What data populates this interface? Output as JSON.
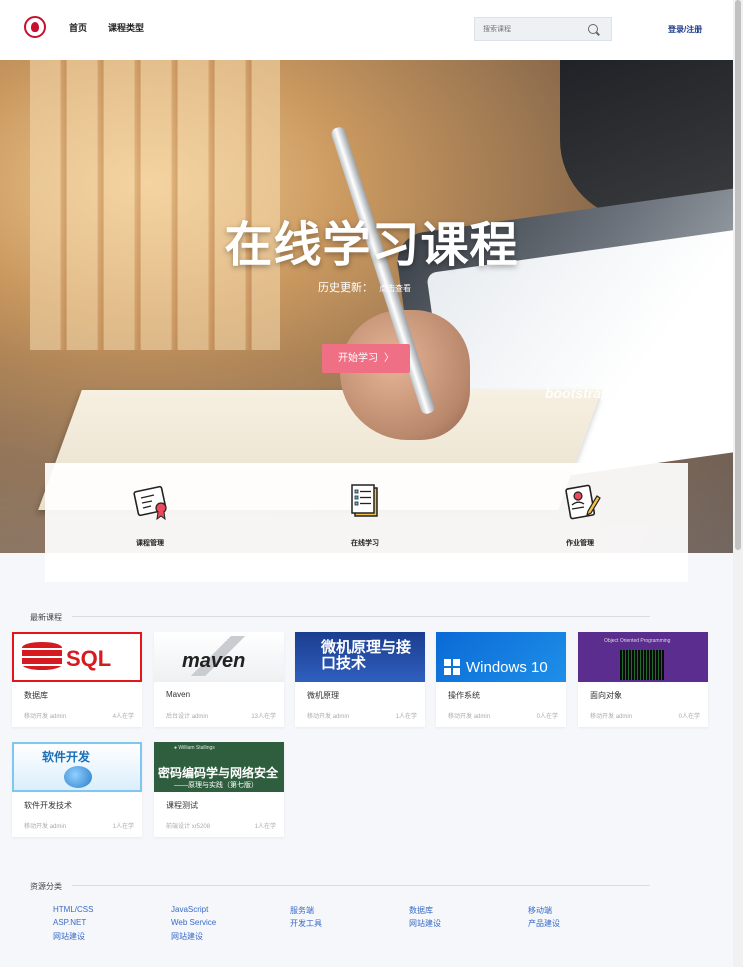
{
  "header": {
    "nav": [
      {
        "label": "首页"
      },
      {
        "label": "课程类型"
      }
    ],
    "search": {
      "placeholder": "搜索课程"
    },
    "login_label": "登录/注册"
  },
  "hero": {
    "title": "在线学习课程",
    "update_label": "历史更新：",
    "update_link": "点击查看",
    "start_button": "开始学习",
    "start_chevron": "〉",
    "watermark": "bootstrapmb.com"
  },
  "features": [
    {
      "label": "课程管理",
      "icon": "certificate-icon"
    },
    {
      "label": "在线学习",
      "icon": "document-icon"
    },
    {
      "label": "作业管理",
      "icon": "resume-edit-icon"
    }
  ],
  "courses": {
    "section_title": "最新课程",
    "items": [
      {
        "name": "数据库",
        "category": "移动开发",
        "author": "admin",
        "count": "4人在学",
        "thumb_text": "SQL"
      },
      {
        "name": "Maven",
        "category": "后台设计",
        "author": "admin",
        "count": "13人在学",
        "thumb_text": "maven"
      },
      {
        "name": "微机原理",
        "category": "移动开发",
        "author": "admin",
        "count": "1人在学",
        "thumb_text": "微机原理与接口技术"
      },
      {
        "name": "操作系统",
        "category": "移动开发",
        "author": "admin",
        "count": "0人在学",
        "thumb_text": "Windows 10"
      },
      {
        "name": "面向对象",
        "category": "移动开发",
        "author": "admin",
        "count": "0人在学",
        "thumb_text": "Object Oriented Programming"
      },
      {
        "name": "软件开发技术",
        "category": "移动开发",
        "author": "admin",
        "count": "1人在学",
        "thumb_text": "软件开发"
      },
      {
        "name": "课程测试",
        "category": "前端设计",
        "author": "xr5208",
        "count": "1人在学",
        "thumb_text": "密码编码学与网络安全",
        "thumb_sub": "——原理与实践（第七版）",
        "thumb_author": "● William Stallings"
      }
    ]
  },
  "resources": {
    "section_title": "资源分类",
    "columns": [
      [
        "HTML/CSS",
        "ASP.NET",
        "网站建设"
      ],
      [
        "JavaScript",
        "Web Service",
        "网站建设"
      ],
      [
        "服务端",
        "开发工具"
      ],
      [
        "数据库",
        "网站建设"
      ],
      [
        "移动端",
        "产品建设"
      ]
    ]
  },
  "colors": {
    "accent_button": "#ef6f85",
    "login_link": "#1b3a8c",
    "resource_link": "#3a6bc8"
  }
}
